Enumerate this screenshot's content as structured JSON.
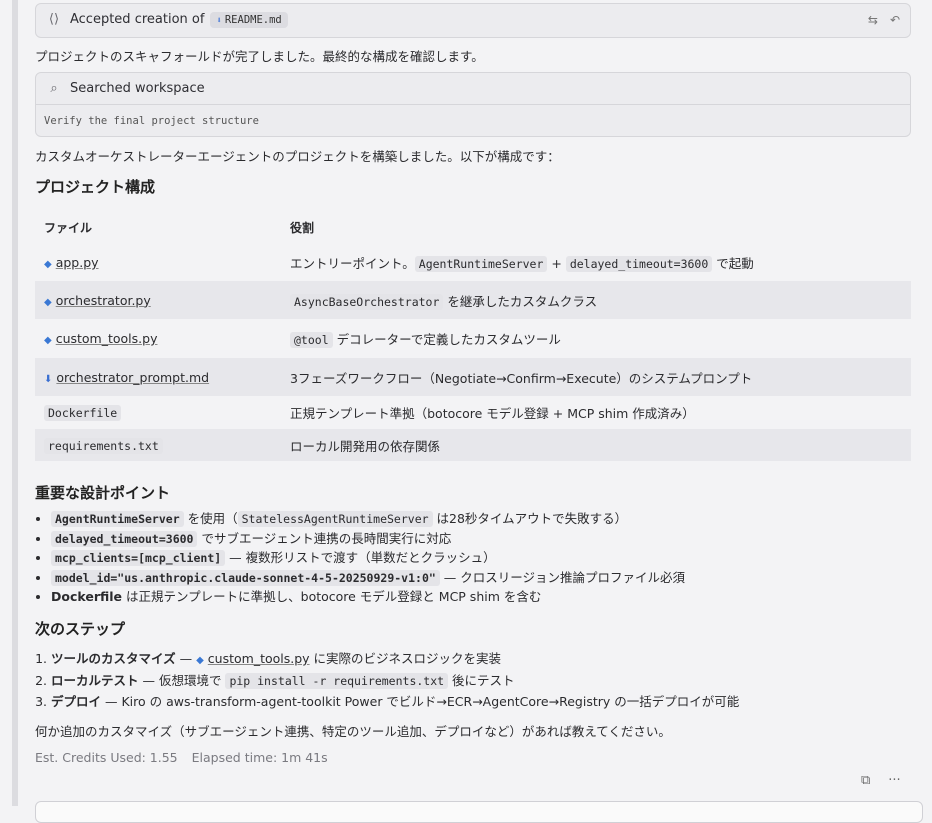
{
  "accepted_card": {
    "title": "Accepted creation of",
    "file": "README.md",
    "icons": [
      "code-diff-icon",
      "compare-icon",
      "undo-icon"
    ]
  },
  "intro": "プロジェクトのスキャフォールドが完了しました。最終的な構成を確認します。",
  "search_card": {
    "title": "Searched workspace",
    "detail": "Verify the final project structure"
  },
  "summary": "カスタムオーケストレーターエージェントのプロジェクトを構築しました。以下が構成です：",
  "structure": {
    "heading": "プロジェクト構成",
    "col_file": "ファイル",
    "col_role": "役割",
    "rows": [
      {
        "file": "app.py",
        "type": "py",
        "role_pre": "エントリーポイント。",
        "code1": "AgentRuntimeServer",
        "mid": " + ",
        "code2": "delayed_timeout=3600",
        "role_post": " で起動"
      },
      {
        "file": "orchestrator.py",
        "type": "py",
        "code1": "AsyncBaseOrchestrator",
        "role_post": " を継承したカスタムクラス"
      },
      {
        "file": "custom_tools.py",
        "type": "py",
        "code1": "@tool",
        "role_post": " デコレーターで定義したカスタムツール"
      },
      {
        "file": "orchestrator_prompt.md",
        "type": "md",
        "role_post": "3フェーズワークフロー（Negotiate→Confirm→Execute）のシステムプロンプト"
      },
      {
        "file": "Dockerfile",
        "type": "code",
        "role_post": "正規テンプレート準拠（botocore モデル登録 + MCP shim 作成済み）"
      },
      {
        "file": "requirements.txt",
        "type": "code",
        "role_post": "ローカル開発用の依存関係"
      }
    ]
  },
  "design": {
    "heading": "重要な設計ポイント",
    "items": [
      {
        "code": "AgentRuntimeServer",
        "t1": " を使用（",
        "code2": "StatelessAgentRuntimeServer",
        "t2": " は28秒タイムアウトで失敗する）"
      },
      {
        "code": "delayed_timeout=3600",
        "t1": " でサブエージェント連携の長時間実行に対応"
      },
      {
        "code": "mcp_clients=[mcp_client]",
        "t1": " — 複数形リストで渡す（単数だとクラッシュ）"
      },
      {
        "code": "model_id=\"us.anthropic.claude-sonnet-4-5-20250929-v1:0\"",
        "t1": " — クロスリージョン推論プロファイル必須"
      },
      {
        "bold": "Dockerfile",
        "t1": " は正規テンプレートに準拠し、botocore モデル登録と MCP shim を含む"
      }
    ]
  },
  "next": {
    "heading": "次のステップ",
    "items": [
      {
        "bold": "ツールのカスタマイズ",
        "t1": " — ",
        "file": "custom_tools.py",
        "t2": " に実際のビジネスロジックを実装"
      },
      {
        "bold": "ローカルテスト",
        "t1": " — 仮想環境で ",
        "code": "pip install -r requirements.txt",
        "t2": " 後にテスト"
      },
      {
        "bold": "デプロイ",
        "t1": " — Kiro の aws-transform-agent-toolkit Power でビルド→ECR→AgentCore→Registry の一括デプロイが可能"
      }
    ]
  },
  "closing": "何か追加のカスタマイズ（サブエージェント連携、特定のツール追加、デプロイなど）があれば教えてください。",
  "stats": {
    "credits_label": "Est. Credits Used: 1.55",
    "elapsed_label": "Elapsed time: 1m 41s"
  }
}
